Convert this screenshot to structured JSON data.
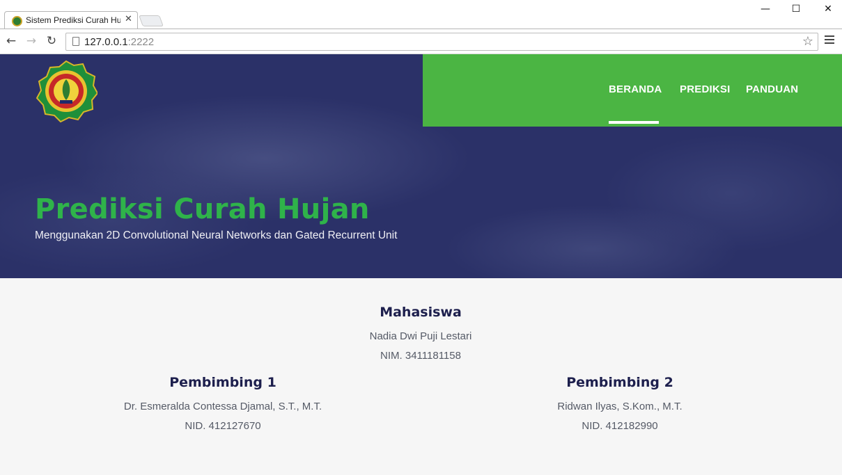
{
  "browser": {
    "tab_title": "Sistem Prediksi Curah Huj",
    "url_host": "127.0.0.1",
    "url_port": ":2222",
    "colors": {
      "accent": "#4bb543"
    }
  },
  "nav": {
    "items": [
      {
        "label": "BERANDA",
        "active": true
      },
      {
        "label": "PREDIKSI",
        "active": false
      },
      {
        "label": "PANDUAN",
        "active": false
      }
    ]
  },
  "hero": {
    "title": "Prediksi Curah Hujan",
    "subtitle": "Menggunakan 2D Convolutional Neural Networks dan Gated Recurrent Unit"
  },
  "people": {
    "mahasiswa": {
      "heading": "Mahasiswa",
      "name": "Nadia Dwi Puji Lestari",
      "id": "NIM. 3411181158"
    },
    "pembimbing1": {
      "heading": "Pembimbing 1",
      "name": "Dr. Esmeralda Contessa Djamal, S.T., M.T.",
      "id": "NID. 412127670"
    },
    "pembimbing2": {
      "heading": "Pembimbing 2",
      "name": "Ridwan Ilyas, S.Kom., M.T.",
      "id": "NID. 412182990"
    }
  },
  "colors": {
    "hero_bg": "#2b3168",
    "nav_bg": "#4bb543",
    "title_green": "#2fb34a",
    "heading_navy": "#1d1f4d"
  }
}
